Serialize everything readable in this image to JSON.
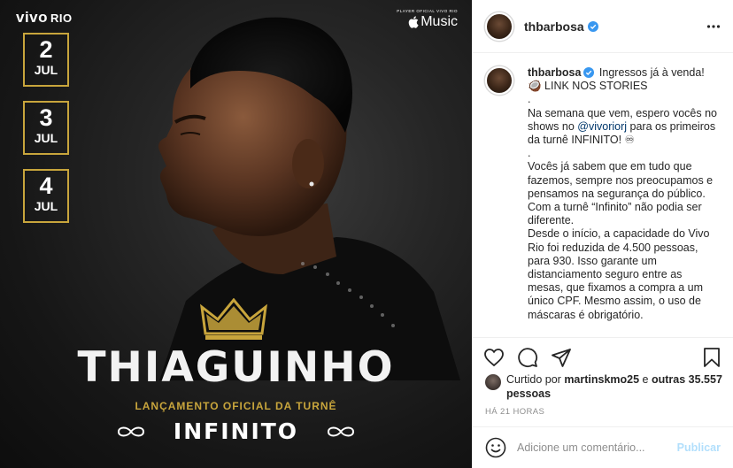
{
  "image": {
    "brand_left": "vivo",
    "brand_left_sub": "RIO",
    "sponsor_text": "PLAYER OFICIAL VIVO RIO",
    "music_label": "Music",
    "dates": [
      {
        "day": "2",
        "month": "JUL"
      },
      {
        "day": "3",
        "month": "JUL"
      },
      {
        "day": "4",
        "month": "JUL"
      }
    ],
    "artist": "THIAGUINHO",
    "launch": "LANÇAMENTO OFICIAL DA TURNÊ",
    "tour": "INFINITO",
    "colors": {
      "gold": "#c8a53c",
      "bg": "#1c1c1c"
    }
  },
  "header": {
    "username": "thbarbosa",
    "more_icon": "more-horizontal-icon"
  },
  "caption": {
    "username": "thbarbosa",
    "line1": "Ingressos já à venda! 🥥 LINK NOS STORIES",
    "dot1": ".",
    "para1_before": "Na semana que vem, espero vocês no shows no ",
    "mention": "@vivoriorj",
    "para1_after": " para os primeiros da turnê INFINITO! ♾",
    "dot2": ".",
    "para2": "Vocês já sabem que em tudo que fazemos, sempre nos preocupamos e pensamos na segurança do público. Com a turnê “Infinito” não podia ser diferente.",
    "para3": "Desde o início, a capacidade do Vivo Rio foi reduzida de 4.500 pessoas, para 930. Isso garante um distanciamento seguro entre as mesas, que fixamos a compra a um único CPF. Mesmo assim, o uso de máscaras é obrigatório."
  },
  "likes": {
    "prefix": "Curtido por ",
    "user": "martinskmo25",
    "middle": " e ",
    "others": "outras 35.557 pessoas"
  },
  "timestamp": "HÁ 21 HORAS",
  "add_comment": {
    "placeholder": "Adicione um comentário...",
    "publish": "Publicar"
  },
  "colors": {
    "verified": "#3897f0",
    "mention": "#00376b",
    "publish_disabled": "#b2dffc",
    "muted": "#8e8e8e"
  }
}
